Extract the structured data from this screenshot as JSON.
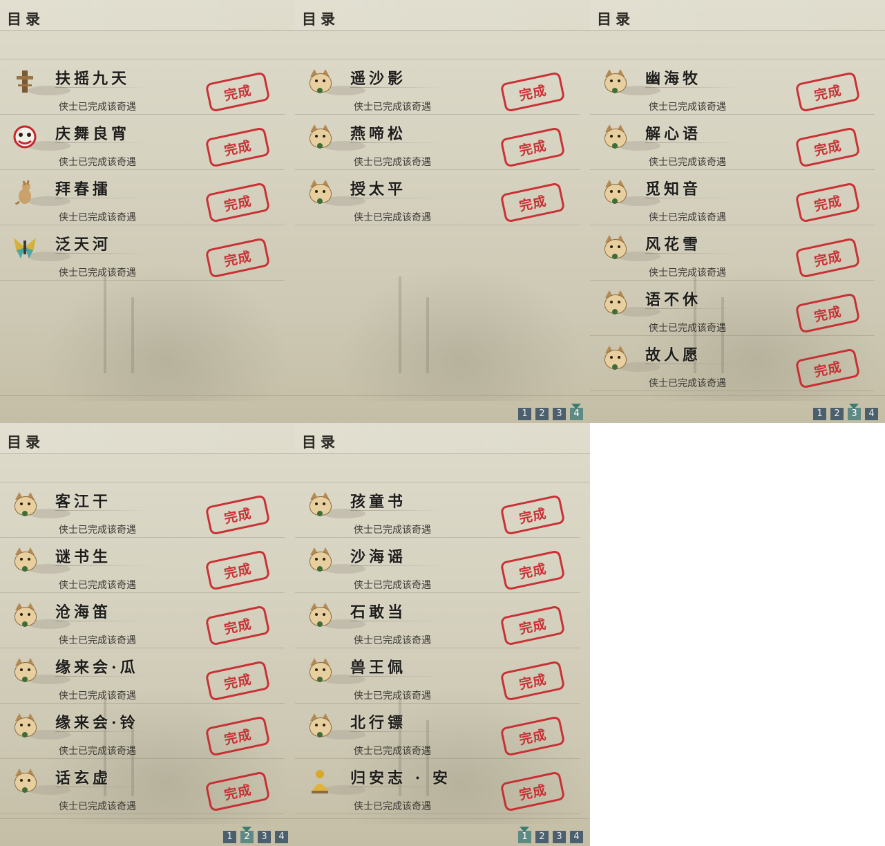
{
  "panels": [
    {
      "title": "目录",
      "entries": [
        {
          "icon": "pillar-icon",
          "name": "扶摇九天",
          "status": "侠士已完成该奇遇",
          "stamp": "完成"
        },
        {
          "icon": "lion-dance-icon",
          "name": "庆舞良宵",
          "status": "侠士已完成该奇遇",
          "stamp": "完成"
        },
        {
          "icon": "kangaroo-icon",
          "name": "拜春擂",
          "status": "侠士已完成该奇遇",
          "stamp": "完成"
        },
        {
          "icon": "moth-icon",
          "name": "泛天河",
          "status": "侠士已完成该奇遇",
          "stamp": "完成"
        }
      ],
      "pager": []
    },
    {
      "title": "目录",
      "entries": [
        {
          "icon": "cat-icon",
          "name": "遥沙影",
          "status": "侠士已完成该奇遇",
          "stamp": "完成"
        },
        {
          "icon": "cat-icon",
          "name": "燕啼松",
          "status": "侠士已完成该奇遇",
          "stamp": "完成"
        },
        {
          "icon": "cat-icon",
          "name": "授太平",
          "status": "侠士已完成该奇遇",
          "stamp": "完成"
        }
      ],
      "pager": [
        {
          "label": "1",
          "active": false
        },
        {
          "label": "2",
          "active": false
        },
        {
          "label": "3",
          "active": false
        },
        {
          "label": "4",
          "active": true
        }
      ]
    },
    {
      "title": "目录",
      "entries": [
        {
          "icon": "cat-icon",
          "name": "幽海牧",
          "status": "侠士已完成该奇遇",
          "stamp": "完成"
        },
        {
          "icon": "cat-icon",
          "name": "解心语",
          "status": "侠士已完成该奇遇",
          "stamp": "完成"
        },
        {
          "icon": "cat-icon",
          "name": "觅知音",
          "status": "侠士已完成该奇遇",
          "stamp": "完成"
        },
        {
          "icon": "cat-icon",
          "name": "风花雪",
          "status": "侠士已完成该奇遇",
          "stamp": "完成"
        },
        {
          "icon": "cat-icon",
          "name": "语不休",
          "status": "侠士已完成该奇遇",
          "stamp": "完成"
        },
        {
          "icon": "cat-icon",
          "name": "故人愿",
          "status": "侠士已完成该奇遇",
          "stamp": "完成"
        }
      ],
      "pager": [
        {
          "label": "1",
          "active": false
        },
        {
          "label": "2",
          "active": false
        },
        {
          "label": "3",
          "active": true
        },
        {
          "label": "4",
          "active": false
        }
      ]
    },
    {
      "title": "目录",
      "entries": [
        {
          "icon": "cat-icon",
          "name": "客江干",
          "status": "侠士已完成该奇遇",
          "stamp": "完成"
        },
        {
          "icon": "cat-icon",
          "name": "谜书生",
          "status": "侠士已完成该奇遇",
          "stamp": "完成"
        },
        {
          "icon": "cat-icon",
          "name": "沧海笛",
          "status": "侠士已完成该奇遇",
          "stamp": "完成"
        },
        {
          "icon": "cat-icon",
          "name": "缘来会·瓜",
          "status": "侠士已完成该奇遇",
          "stamp": "完成"
        },
        {
          "icon": "cat-icon",
          "name": "缘来会·铃",
          "status": "侠士已完成该奇遇",
          "stamp": "完成"
        },
        {
          "icon": "cat-icon",
          "name": "话玄虚",
          "status": "侠士已完成该奇遇",
          "stamp": "完成"
        }
      ],
      "pager": [
        {
          "label": "1",
          "active": false
        },
        {
          "label": "2",
          "active": true
        },
        {
          "label": "3",
          "active": false
        },
        {
          "label": "4",
          "active": false
        }
      ]
    },
    {
      "title": "目录",
      "entries": [
        {
          "icon": "cat-icon",
          "name": "孩童书",
          "status": "侠士已完成该奇遇",
          "stamp": "完成"
        },
        {
          "icon": "cat-icon",
          "name": "沙海谣",
          "status": "侠士已完成该奇遇",
          "stamp": "完成"
        },
        {
          "icon": "cat-icon",
          "name": "石敢当",
          "status": "侠士已完成该奇遇",
          "stamp": "完成"
        },
        {
          "icon": "cat-icon",
          "name": "兽王佩",
          "status": "侠士已完成该奇遇",
          "stamp": "完成"
        },
        {
          "icon": "cat-icon",
          "name": "北行镖",
          "status": "侠士已完成该奇遇",
          "stamp": "完成"
        },
        {
          "icon": "buddha-icon",
          "name": "归安志 · 安",
          "status": "侠士已完成该奇遇",
          "stamp": "完成"
        }
      ],
      "pager": [
        {
          "label": "1",
          "active": true
        },
        {
          "label": "2",
          "active": false
        },
        {
          "label": "3",
          "active": false
        },
        {
          "label": "4",
          "active": false
        }
      ]
    }
  ]
}
